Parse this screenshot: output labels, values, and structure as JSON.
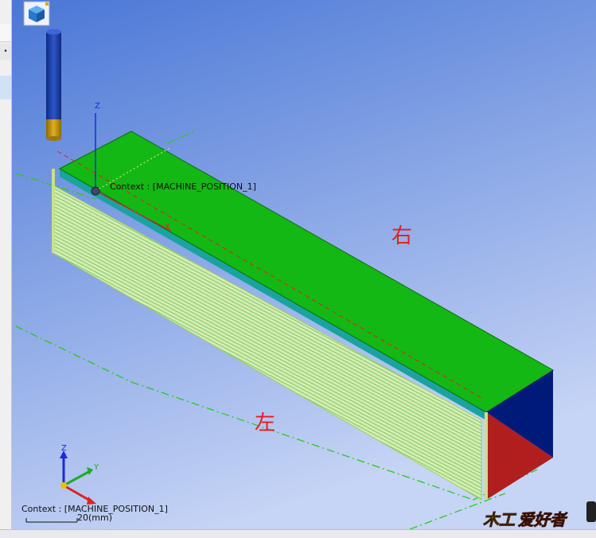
{
  "viewport": {
    "background_top": "#4a77d6",
    "background_bottom": "#c6d4f5",
    "context_label": "Context : [MACHINE_POSITION_1]",
    "triad_context_label": "Context : [MACHINE_POSITION_1]",
    "scale_label": "20(mm)",
    "face_label_right": "右",
    "face_label_left": "左",
    "axis_labels": {
      "z": "Z",
      "x": "X",
      "y": "Y"
    },
    "stock_colors": {
      "top": "#14b814",
      "side": "#cfe8a8",
      "end_left": "#001a7a",
      "end_right": "#b01e1e",
      "edge": "#1aa3a0"
    },
    "tool_colors": {
      "shank": "#1a3ea8",
      "tip": "#c89a10"
    }
  },
  "watermark": {
    "text_a": "木工",
    "text_b": "爱好者"
  },
  "icons": {
    "view_cube": "cube-icon",
    "side_tab": "tab-icon"
  }
}
